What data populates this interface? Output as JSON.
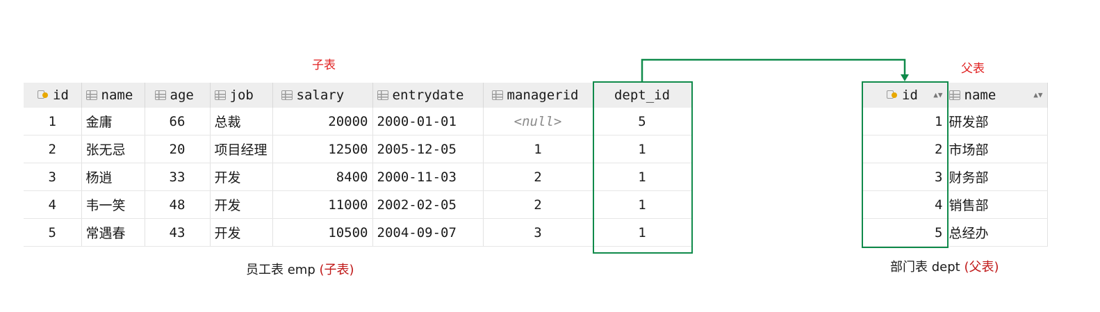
{
  "labels": {
    "child_marker": "子表",
    "parent_marker": "父表"
  },
  "emp": {
    "columns": [
      "id",
      "name",
      "age",
      "job",
      "salary",
      "entrydate",
      "managerid",
      "dept_id"
    ],
    "rows": [
      [
        "1",
        "金庸",
        "66",
        "总裁",
        "20000",
        "2000-01-01",
        "<null>",
        "5"
      ],
      [
        "2",
        "张无忌",
        "20",
        "项目经理",
        "12500",
        "2005-12-05",
        "1",
        "1"
      ],
      [
        "3",
        "杨逍",
        "33",
        "开发",
        "8400",
        "2000-11-03",
        "2",
        "1"
      ],
      [
        "4",
        "韦一笑",
        "48",
        "开发",
        "11000",
        "2002-02-05",
        "2",
        "1"
      ],
      [
        "5",
        "常遇春",
        "43",
        "开发",
        "10500",
        "2004-09-07",
        "3",
        "1"
      ]
    ],
    "caption_prefix": "员工表 emp ",
    "caption_suffix": "(子表)"
  },
  "dept": {
    "columns": [
      "id",
      "name"
    ],
    "rows": [
      [
        "1",
        "研发部"
      ],
      [
        "2",
        "市场部"
      ],
      [
        "3",
        "财务部"
      ],
      [
        "4",
        "销售部"
      ],
      [
        "5",
        "总经办"
      ]
    ],
    "caption_prefix": "部门表 dept ",
    "caption_suffix": "(父表)"
  },
  "colors": {
    "highlight": "#0f8a4a",
    "marker": "#e02020"
  },
  "icons": {
    "primary_key": "key-column-icon",
    "column": "column-icon",
    "sort": "sort-arrows-icon"
  }
}
